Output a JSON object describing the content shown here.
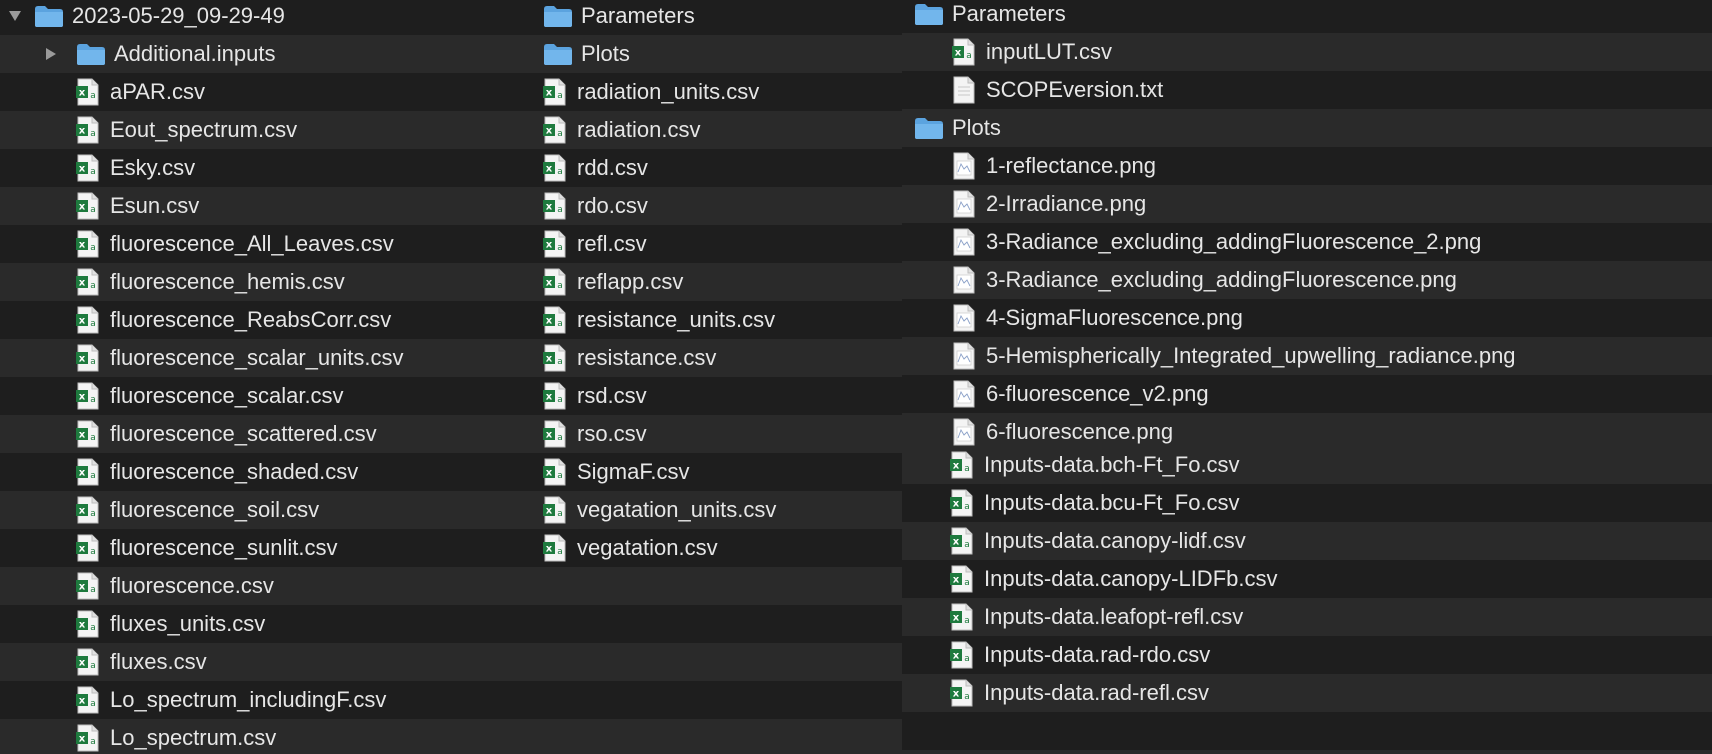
{
  "colors": {
    "bg": "#1e1e1e",
    "stripe": "#2a2a2a",
    "text": "#e6e6e6",
    "folder": "#5ba3df",
    "excel": "#1e7a3e"
  },
  "icons": {
    "disclosure_open": "triangle-down-icon",
    "disclosure_closed": "triangle-right-icon",
    "folder": "folder-icon",
    "csv": "excel-csv-icon",
    "txt": "text-file-icon",
    "png": "image-file-icon"
  },
  "panes": [
    {
      "id": "p1",
      "rows": [
        {
          "label": "2023-05-29_09-29-49",
          "kind": "folder",
          "disclosure": "open",
          "level": 0
        },
        {
          "label": "Additional.inputs",
          "kind": "folder",
          "disclosure": "closed",
          "level": 1
        },
        {
          "label": "aPAR.csv",
          "kind": "csv",
          "level": 2
        },
        {
          "label": "Eout_spectrum.csv",
          "kind": "csv",
          "level": 2
        },
        {
          "label": "Esky.csv",
          "kind": "csv",
          "level": 2
        },
        {
          "label": "Esun.csv",
          "kind": "csv",
          "level": 2
        },
        {
          "label": "fluorescence_All_Leaves.csv",
          "kind": "csv",
          "level": 2
        },
        {
          "label": "fluorescence_hemis.csv",
          "kind": "csv",
          "level": 2
        },
        {
          "label": "fluorescence_ReabsCorr.csv",
          "kind": "csv",
          "level": 2
        },
        {
          "label": "fluorescence_scalar_units.csv",
          "kind": "csv",
          "level": 2
        },
        {
          "label": "fluorescence_scalar.csv",
          "kind": "csv",
          "level": 2
        },
        {
          "label": "fluorescence_scattered.csv",
          "kind": "csv",
          "level": 2
        },
        {
          "label": "fluorescence_shaded.csv",
          "kind": "csv",
          "level": 2
        },
        {
          "label": "fluorescence_soil.csv",
          "kind": "csv",
          "level": 2
        },
        {
          "label": "fluorescence_sunlit.csv",
          "kind": "csv",
          "level": 2
        },
        {
          "label": "fluorescence.csv",
          "kind": "csv",
          "level": 2
        },
        {
          "label": "fluxes_units.csv",
          "kind": "csv",
          "level": 2
        },
        {
          "label": "fluxes.csv",
          "kind": "csv",
          "level": 2
        },
        {
          "label": "Lo_spectrum_includingF.csv",
          "kind": "csv",
          "level": 2
        },
        {
          "label": "Lo_spectrum.csv",
          "kind": "csv",
          "level": 2
        }
      ]
    },
    {
      "id": "p2",
      "rows": [
        {
          "label": "Parameters",
          "kind": "folder",
          "disclosure": "closed",
          "level": 1
        },
        {
          "label": "Plots",
          "kind": "folder",
          "disclosure": "closed",
          "level": 1
        },
        {
          "label": "radiation_units.csv",
          "kind": "csv",
          "level": 2
        },
        {
          "label": "radiation.csv",
          "kind": "csv",
          "level": 2
        },
        {
          "label": "rdd.csv",
          "kind": "csv",
          "level": 2
        },
        {
          "label": "rdo.csv",
          "kind": "csv",
          "level": 2
        },
        {
          "label": "refl.csv",
          "kind": "csv",
          "level": 2
        },
        {
          "label": "reflapp.csv",
          "kind": "csv",
          "level": 2
        },
        {
          "label": "resistance_units.csv",
          "kind": "csv",
          "level": 2
        },
        {
          "label": "resistance.csv",
          "kind": "csv",
          "level": 2
        },
        {
          "label": "rsd.csv",
          "kind": "csv",
          "level": 2
        },
        {
          "label": "rso.csv",
          "kind": "csv",
          "level": 2
        },
        {
          "label": "SigmaF.csv",
          "kind": "csv",
          "level": 2
        },
        {
          "label": "vegatation_units.csv",
          "kind": "csv",
          "level": 2
        },
        {
          "label": "vegatation.csv",
          "kind": "csv",
          "level": 2
        }
      ]
    },
    {
      "id": "p3",
      "rows": [
        {
          "label": "Parameters",
          "kind": "folder",
          "disclosure": "open",
          "level": 1
        },
        {
          "label": "inputLUT.csv",
          "kind": "csv",
          "level": 2
        },
        {
          "label": "SCOPEversion.txt",
          "kind": "txt",
          "level": 2
        },
        {
          "label": "Plots",
          "kind": "folder",
          "disclosure": "open",
          "level": 1
        },
        {
          "label": "1-reflectance.png",
          "kind": "png",
          "level": 2
        },
        {
          "label": "2-Irradiance.png",
          "kind": "png",
          "level": 2
        },
        {
          "label": "3-Radiance_excluding_addingFluorescence_2.png",
          "kind": "png",
          "level": 2
        },
        {
          "label": "3-Radiance_excluding_addingFluorescence.png",
          "kind": "png",
          "level": 2
        },
        {
          "label": "4-SigmaFluorescence.png",
          "kind": "png",
          "level": 2
        },
        {
          "label": "5-Hemispherically_Integrated_upwelling_radiance.png",
          "kind": "png",
          "level": 2
        },
        {
          "label": "6-fluorescence_v2.png",
          "kind": "png",
          "level": 2
        },
        {
          "label": "6-fluorescence.png",
          "kind": "png",
          "level": 2
        }
      ]
    },
    {
      "id": "p4",
      "rows": [
        {
          "label": "Additional.inputs",
          "kind": "folder",
          "disclosure": "open",
          "level": 1
        },
        {
          "label": "Inputs-data.bch-Ft_Fo.csv",
          "kind": "csv",
          "level": 2
        },
        {
          "label": "Inputs-data.bcu-Ft_Fo.csv",
          "kind": "csv",
          "level": 2
        },
        {
          "label": "Inputs-data.canopy-lidf.csv",
          "kind": "csv",
          "level": 2
        },
        {
          "label": "Inputs-data.canopy-LIDFb.csv",
          "kind": "csv",
          "level": 2
        },
        {
          "label": "Inputs-data.leafopt-refl.csv",
          "kind": "csv",
          "level": 2
        },
        {
          "label": "Inputs-data.rad-rdo.csv",
          "kind": "csv",
          "level": 2
        },
        {
          "label": "Inputs-data.rad-refl.csv",
          "kind": "csv",
          "level": 2
        }
      ]
    }
  ]
}
